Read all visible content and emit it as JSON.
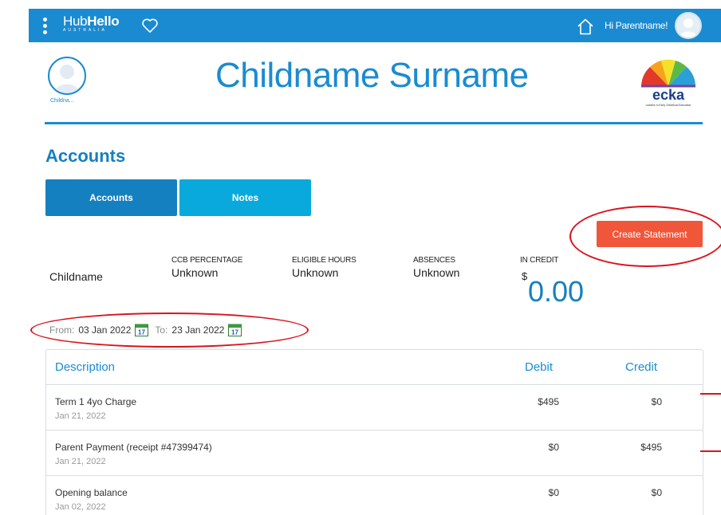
{
  "topbar": {
    "logo_main_light": "Hub",
    "logo_main_bold": "Hello",
    "logo_sub": "AUSTRALIA",
    "greeting": "Hi Parentname!",
    "icons": [
      "menu-dots-icon",
      "heart-icon",
      "home-icon",
      "user-avatar"
    ]
  },
  "header": {
    "child_label": "Childna...",
    "title": "Childname Surname",
    "brand_text": "ecka",
    "brand_tagline": "Leaders in Early Childhood Education"
  },
  "section": {
    "title": "Accounts"
  },
  "tabs": [
    {
      "label": "Accounts",
      "active": true
    },
    {
      "label": "Notes",
      "active": false
    }
  ],
  "actions": {
    "create_statement": "Create Statement"
  },
  "summary": {
    "name": "Childname",
    "ccb_label": "CCB PERCENTAGE",
    "ccb_value": "Unknown",
    "hours_label": "ELIGIBLE HOURS",
    "hours_value": "Unknown",
    "absences_label": "ABSENCES",
    "absences_value": "Unknown",
    "credit_label": "IN CREDIT",
    "credit_currency": "$",
    "credit_amount": "0.00"
  },
  "date_range": {
    "from_label": "From:",
    "from_value": "03 Jan 2022",
    "to_label": "To:",
    "to_value": "23 Jan 2022",
    "calendar_day": "17"
  },
  "table": {
    "headers": {
      "description": "Description",
      "debit": "Debit",
      "credit": "Credit"
    },
    "rows": [
      {
        "description": "Term 1 4yo Charge",
        "date": "Jan 21, 2022",
        "debit": "$495",
        "credit": "$0"
      },
      {
        "description": "Parent Payment (receipt #47399474)",
        "date": "Jan 21, 2022",
        "debit": "$0",
        "credit": "$495"
      },
      {
        "description": "Opening balance",
        "date": "Jan 02, 2022",
        "debit": "$0",
        "credit": "$0"
      }
    ]
  },
  "colors": {
    "primary": "#1a8bd1",
    "tab_active": "#1580c0",
    "tab_inactive": "#0aa9dc",
    "action": "#f0573a",
    "annotation": "#d9141e"
  }
}
